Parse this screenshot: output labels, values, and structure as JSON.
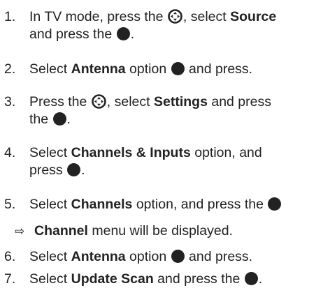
{
  "steps": [
    {
      "number": "1.",
      "line1": {
        "a": "In TV mode, press the",
        "b": ", select",
        "bold": "Source"
      },
      "line2": {
        "a": "and press the",
        "b": "."
      }
    },
    {
      "number": "2.",
      "line1": {
        "a": "Select",
        "bold": "Antenna",
        "b": "option",
        "c": "and press."
      }
    },
    {
      "number": "3.",
      "line1": {
        "a": "Press the",
        "b": ", select",
        "bold": "Settings",
        "c": "and press"
      },
      "line2": {
        "a": "the",
        "b": "."
      }
    },
    {
      "number": "4.",
      "line1": {
        "a": "Select",
        "bold": "Channels & Inputs",
        "b": "option, and"
      },
      "line2": {
        "a": "press",
        "b": "."
      }
    },
    {
      "number": "5.",
      "line1": {
        "a": "Select",
        "bold": "Channels",
        "b": "option, and press the"
      }
    },
    {
      "arrow": "⇨",
      "bold": "Channel",
      "text": "menu will be displayed."
    },
    {
      "number": "6.",
      "line1": {
        "a": "Select",
        "bold": "Antenna",
        "b": "option",
        "c": "and press."
      }
    },
    {
      "number": "7.",
      "line1": {
        "a": "Select",
        "bold": "Update Scan",
        "b": "and press the",
        "c": "."
      }
    }
  ],
  "icons": {
    "navigation": "navigation-pad-icon",
    "ok": "ok-button-icon"
  },
  "colors": {
    "text": "#222222",
    "background": "#ffffff"
  }
}
